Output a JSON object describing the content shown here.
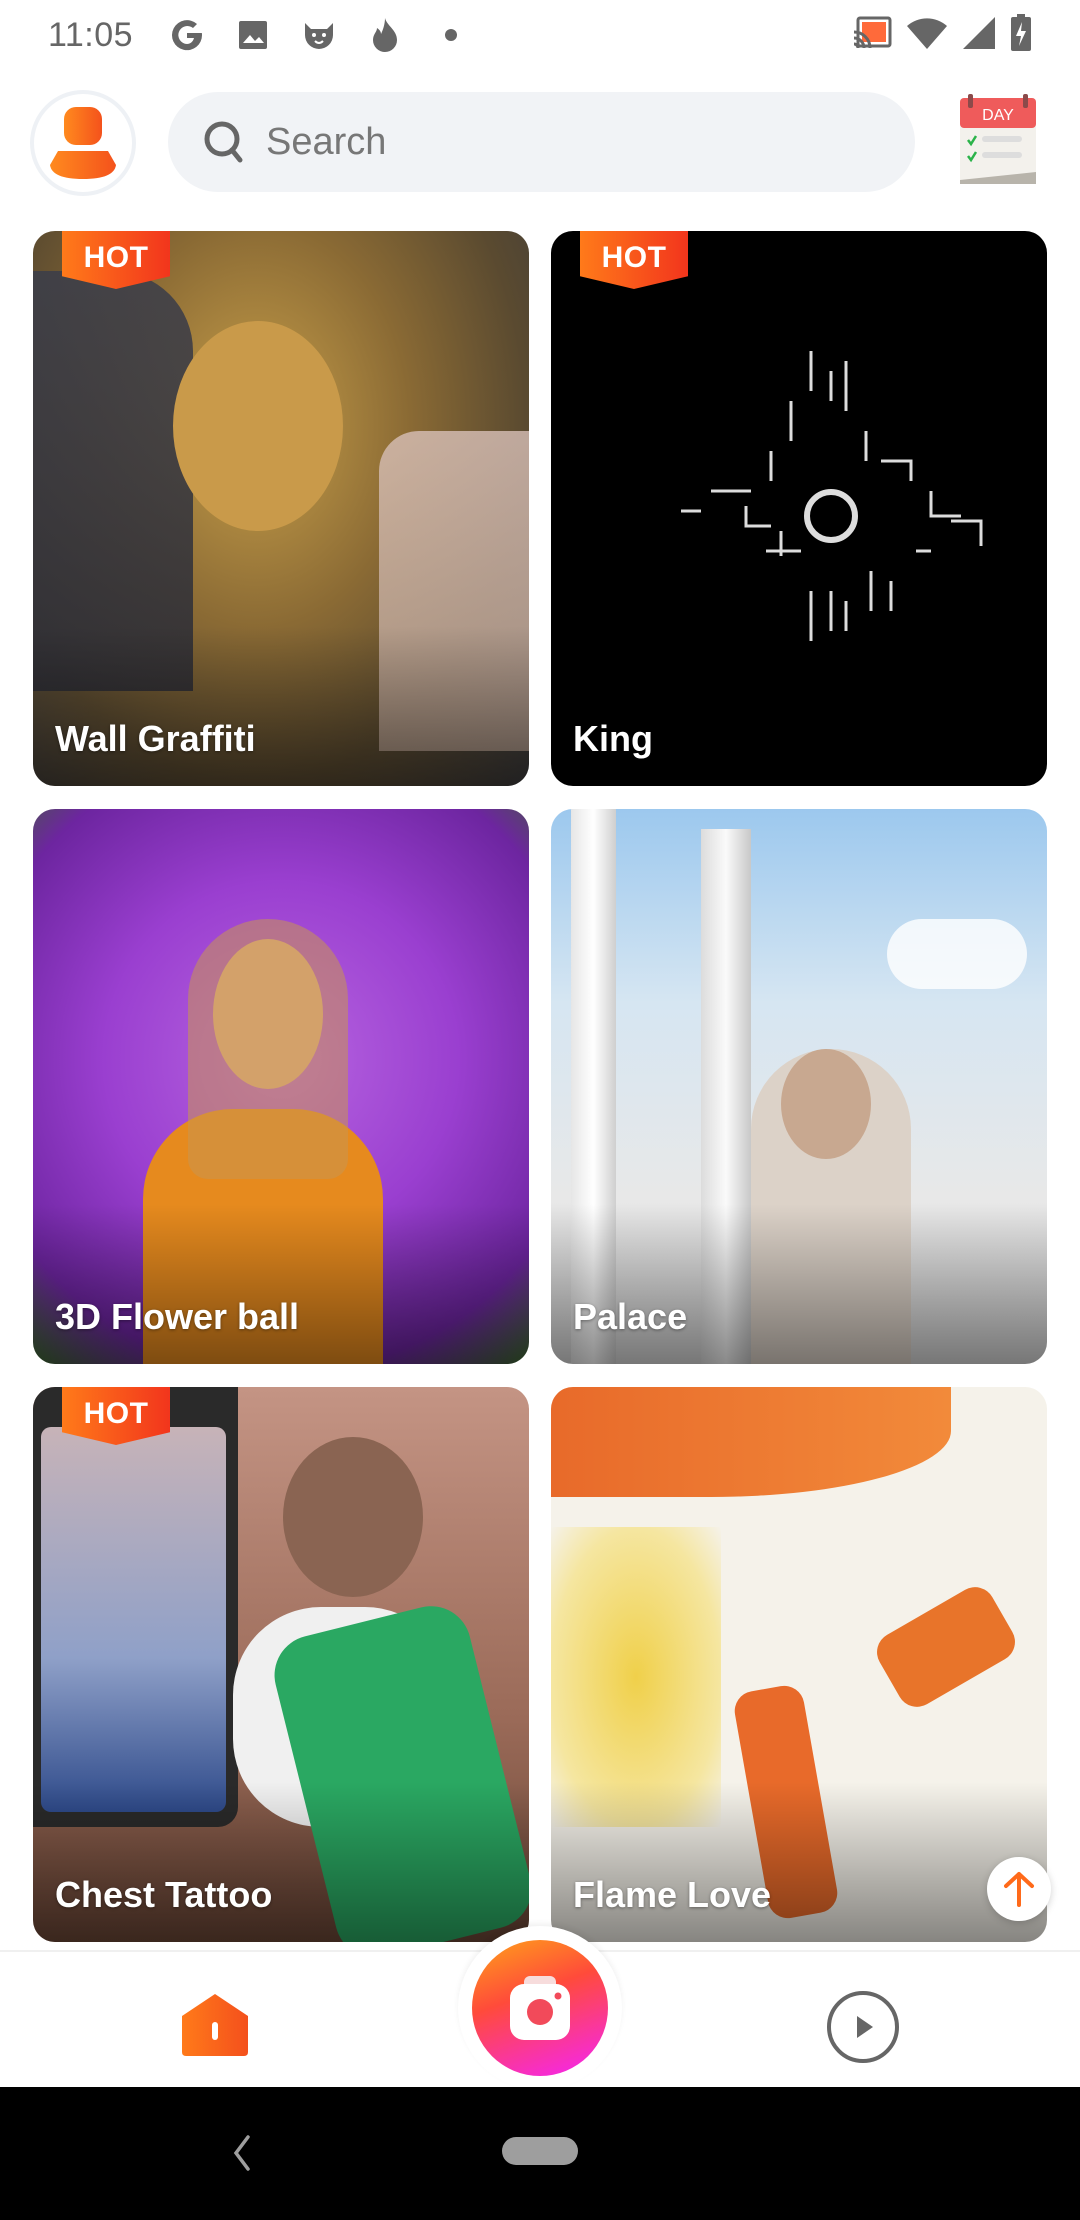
{
  "status_bar": {
    "time": "11:05",
    "left_icons": [
      "google-icon",
      "gallery-icon",
      "cat-app-icon",
      "fire-app-icon",
      "more-notifications-dot"
    ],
    "right_icons": [
      "cast-icon",
      "wifi-icon",
      "cell-signal-icon",
      "battery-charging-icon"
    ]
  },
  "header": {
    "avatar_icon": "user-profile-icon",
    "search_placeholder": "Search",
    "calendar_label": "DAY"
  },
  "cards": [
    {
      "title": "Wall Graffiti",
      "hot": true,
      "badge": "HOT"
    },
    {
      "title": "King",
      "hot": true,
      "badge": "HOT"
    },
    {
      "title": "3D Flower ball",
      "hot": false
    },
    {
      "title": "Palace",
      "hot": false
    },
    {
      "title": "Chest Tattoo",
      "hot": true,
      "badge": "HOT"
    },
    {
      "title": "Flame Love",
      "hot": false
    }
  ],
  "bottom_nav": {
    "items": [
      "home-icon",
      "camera-icon",
      "play-icon"
    ],
    "active": "home"
  },
  "colors": {
    "accent": "#ff6a1a",
    "hot_badge": "#f2351c",
    "search_bg": "#f1f3f6"
  }
}
